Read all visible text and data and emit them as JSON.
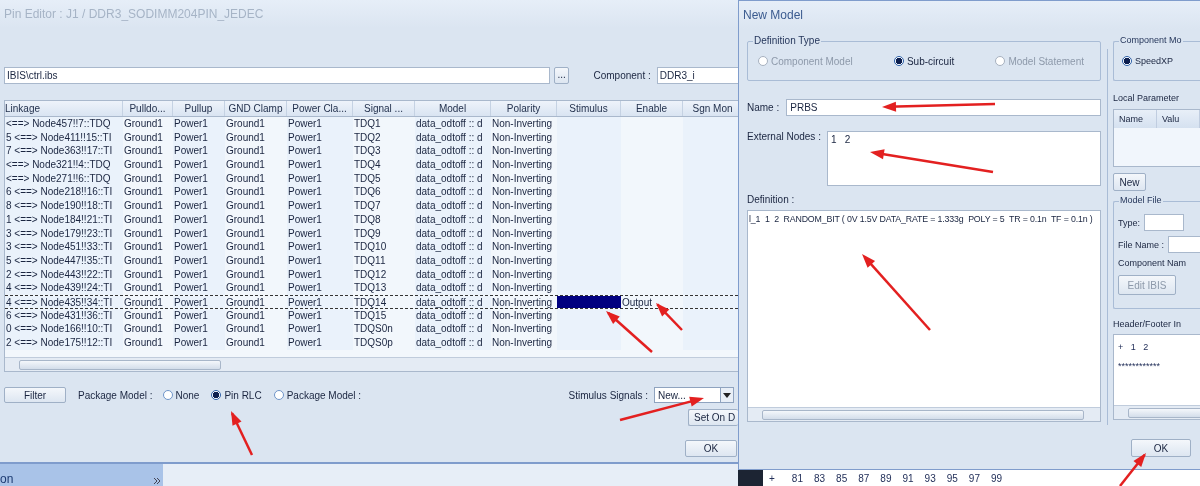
{
  "pin_editor": {
    "title": "Pin Editor : J1 / DDR3_SODIMM204PIN_JEDEC",
    "ibis_file": {
      "value": "IBIS\\ctrl.ibs"
    },
    "browse_button": "...",
    "component_label": "Component :",
    "component": {
      "value": "DDR3_i"
    },
    "table": {
      "columns": [
        "Linkage",
        "Pulldo...",
        "Pullup",
        "GND Clamp",
        "Power Cla...",
        "Signal ...",
        "Model",
        "Polarity",
        "Stimulus",
        "Enable",
        "Sgn Mon"
      ],
      "rows": [
        {
          "linkage": "<==> Node457!!7::TDQ",
          "pulldown": "Ground1",
          "pullup": "Power1",
          "gnd_clamp": "Ground1",
          "power_clamp": "Power1",
          "signal": "TDQ1",
          "model": "data_odtoff :: d",
          "polarity": "Non-Inverting",
          "selected": false,
          "stimulus_set": false
        },
        {
          "linkage": "5 <==> Node411!!15::TI",
          "pulldown": "Ground1",
          "pullup": "Power1",
          "gnd_clamp": "Ground1",
          "power_clamp": "Power1",
          "signal": "TDQ2",
          "model": "data_odtoff :: d",
          "polarity": "Non-Inverting",
          "selected": false,
          "stimulus_set": false
        },
        {
          "linkage": "7 <==> Node363!!17::TI",
          "pulldown": "Ground1",
          "pullup": "Power1",
          "gnd_clamp": "Ground1",
          "power_clamp": "Power1",
          "signal": "TDQ3",
          "model": "data_odtoff :: d",
          "polarity": "Non-Inverting",
          "selected": false,
          "stimulus_set": false
        },
        {
          "linkage": "<==> Node321!!4::TDQ",
          "pulldown": "Ground1",
          "pullup": "Power1",
          "gnd_clamp": "Ground1",
          "power_clamp": "Power1",
          "signal": "TDQ4",
          "model": "data_odtoff :: d",
          "polarity": "Non-Inverting",
          "selected": false,
          "stimulus_set": false
        },
        {
          "linkage": "<==> Node271!!6::TDQ",
          "pulldown": "Ground1",
          "pullup": "Power1",
          "gnd_clamp": "Ground1",
          "power_clamp": "Power1",
          "signal": "TDQ5",
          "model": "data_odtoff :: d",
          "polarity": "Non-Inverting",
          "selected": false,
          "stimulus_set": false
        },
        {
          "linkage": "6 <==> Node218!!16::TI",
          "pulldown": "Ground1",
          "pullup": "Power1",
          "gnd_clamp": "Ground1",
          "power_clamp": "Power1",
          "signal": "TDQ6",
          "model": "data_odtoff :: d",
          "polarity": "Non-Inverting",
          "selected": false,
          "stimulus_set": false
        },
        {
          "linkage": "8 <==> Node190!!18::TI",
          "pulldown": "Ground1",
          "pullup": "Power1",
          "gnd_clamp": "Ground1",
          "power_clamp": "Power1",
          "signal": "TDQ7",
          "model": "data_odtoff :: d",
          "polarity": "Non-Inverting",
          "selected": false,
          "stimulus_set": false
        },
        {
          "linkage": "1 <==> Node184!!21::TI",
          "pulldown": "Ground1",
          "pullup": "Power1",
          "gnd_clamp": "Ground1",
          "power_clamp": "Power1",
          "signal": "TDQ8",
          "model": "data_odtoff :: d",
          "polarity": "Non-Inverting",
          "selected": false,
          "stimulus_set": false
        },
        {
          "linkage": "3 <==> Node179!!23::TI",
          "pulldown": "Ground1",
          "pullup": "Power1",
          "gnd_clamp": "Ground1",
          "power_clamp": "Power1",
          "signal": "TDQ9",
          "model": "data_odtoff :: d",
          "polarity": "Non-Inverting",
          "selected": false,
          "stimulus_set": false
        },
        {
          "linkage": "3 <==> Node451!!33::TI",
          "pulldown": "Ground1",
          "pullup": "Power1",
          "gnd_clamp": "Ground1",
          "power_clamp": "Power1",
          "signal": "TDQ10",
          "model": "data_odtoff :: d",
          "polarity": "Non-Inverting",
          "selected": false,
          "stimulus_set": false
        },
        {
          "linkage": "5 <==> Node447!!35::TI",
          "pulldown": "Ground1",
          "pullup": "Power1",
          "gnd_clamp": "Ground1",
          "power_clamp": "Power1",
          "signal": "TDQ11",
          "model": "data_odtoff :: d",
          "polarity": "Non-Inverting",
          "selected": false,
          "stimulus_set": false
        },
        {
          "linkage": "2 <==> Node443!!22::TI",
          "pulldown": "Ground1",
          "pullup": "Power1",
          "gnd_clamp": "Ground1",
          "power_clamp": "Power1",
          "signal": "TDQ12",
          "model": "data_odtoff :: d",
          "polarity": "Non-Inverting",
          "selected": false,
          "stimulus_set": false
        },
        {
          "linkage": "4 <==> Node439!!24::TI",
          "pulldown": "Ground1",
          "pullup": "Power1",
          "gnd_clamp": "Ground1",
          "power_clamp": "Power1",
          "signal": "TDQ13",
          "model": "data_odtoff :: d",
          "polarity": "Non-Inverting",
          "selected": false,
          "stimulus_set": false
        },
        {
          "linkage": "4 <==> Node435!!34::TI",
          "pulldown": "Ground1",
          "pullup": "Power1",
          "gnd_clamp": "Ground1",
          "power_clamp": "Power1",
          "signal": "TDQ14",
          "model": "data_odtoff :: d",
          "polarity": "Non-Inverting",
          "selected": true,
          "stimulus_set": true,
          "enable": "Output"
        },
        {
          "linkage": "6 <==> Node431!!36::TI",
          "pulldown": "Ground1",
          "pullup": "Power1",
          "gnd_clamp": "Ground1",
          "power_clamp": "Power1",
          "signal": "TDQ15",
          "model": "data_odtoff :: d",
          "polarity": "Non-Inverting",
          "selected": false,
          "stimulus_set": false
        },
        {
          "linkage": "0 <==> Node166!!10::TI",
          "pulldown": "Ground1",
          "pullup": "Power1",
          "gnd_clamp": "Ground1",
          "power_clamp": "Power1",
          "signal": "TDQS0n",
          "model": "data_odtoff :: d",
          "polarity": "Non-Inverting",
          "selected": false,
          "stimulus_set": false
        },
        {
          "linkage": "2 <==> Node175!!12::TI",
          "pulldown": "Ground1",
          "pullup": "Power1",
          "gnd_clamp": "Ground1",
          "power_clamp": "Power1",
          "signal": "TDQS0p",
          "model": "data_odtoff :: d",
          "polarity": "Non-Inverting",
          "selected": false,
          "stimulus_set": false
        }
      ]
    },
    "filter_button": "Filter",
    "package_model_label": "Package Model :",
    "package_options": [
      {
        "label": "None",
        "selected": false
      },
      {
        "label": "Pin RLC",
        "selected": true
      },
      {
        "label": "Package Model :",
        "selected": false
      }
    ],
    "stimulus_label": "Stimulus Signals :",
    "stimulus_signals": {
      "value": "New..."
    },
    "set_on_button": "Set On D",
    "ok_button": "OK"
  },
  "new_model": {
    "title": "New Model",
    "definition_type": {
      "label": "Definition Type",
      "options": [
        {
          "label": "Component Model",
          "selected": false,
          "disabled": true
        },
        {
          "label": "Sub-circuit",
          "selected": true,
          "disabled": false
        },
        {
          "label": "Model Statement",
          "selected": false,
          "disabled": true
        }
      ]
    },
    "name": {
      "label": "Name :",
      "value": "PRBS"
    },
    "external_nodes": {
      "label": "External Nodes :",
      "value": "1   2"
    },
    "definition": {
      "label": "Definition :",
      "value": "l_1  1  2  RANDOM_BIT ( 0V 1.5V DATA_RATE = 1.333g  POLY = 5  TR = 0.1n  TF = 0.1n )"
    },
    "component_model": {
      "label": "Component Mo",
      "options": [
        {
          "label": "SpeedXP",
          "selected": true
        }
      ]
    },
    "local_parameters": {
      "label": "Local Parameter",
      "columns": [
        "Name",
        "Valu"
      ]
    },
    "new_button": "New",
    "model_file": {
      "label": "Model File",
      "type_label": "Type:",
      "file_name_label": "File Name :",
      "component_name_label": "Component Nam",
      "edit_button": {
        "label": "Edit IBIS",
        "disabled": true
      }
    },
    "header_footer": {
      "label": "Header/Footer In",
      "lines": [
        "+   1   2",
        "************"
      ]
    },
    "ok_button": "OK"
  },
  "background": {
    "sidebar_label": "on",
    "numbers": [
      "+",
      "81",
      "83",
      "85",
      "87",
      "89",
      "91",
      "93",
      "95",
      "97",
      "99"
    ]
  }
}
